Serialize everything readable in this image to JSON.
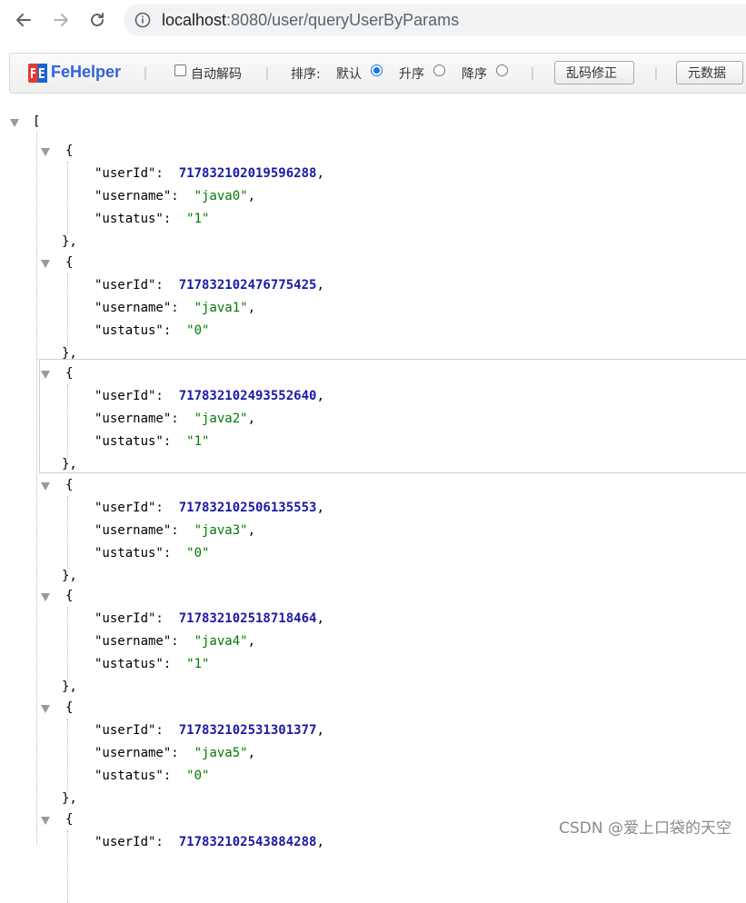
{
  "browser": {
    "url_host": "localhost",
    "url_rest": ":8080/user/queryUserByParams"
  },
  "toolbar": {
    "brand": "FeHelper",
    "auto_decode_label": "自动解码",
    "sort_label": "排序:",
    "sort_default": "默认",
    "sort_asc": "升序",
    "sort_desc": "降序",
    "fix_garbled_button": "乱码修正",
    "metadata_button": "元数据",
    "sort_selected": "默认",
    "accent_color": "#3363d8"
  },
  "json": {
    "open_bracket": "[",
    "records": [
      {
        "userId": "717832102019596288",
        "username": "java0",
        "ustatus": "1"
      },
      {
        "userId": "717832102476775425",
        "username": "java1",
        "ustatus": "0"
      },
      {
        "userId": "717832102493552640",
        "username": "java2",
        "ustatus": "1"
      },
      {
        "userId": "717832102506135553",
        "username": "java3",
        "ustatus": "0"
      },
      {
        "userId": "717832102518718464",
        "username": "java4",
        "ustatus": "1"
      },
      {
        "userId": "717832102531301377",
        "username": "java5",
        "ustatus": "0"
      },
      {
        "userId": "717832102543884288"
      }
    ],
    "keys": {
      "userId": "userId",
      "username": "username",
      "ustatus": "ustatus"
    }
  },
  "watermark": "CSDN @爱上口袋的天空"
}
